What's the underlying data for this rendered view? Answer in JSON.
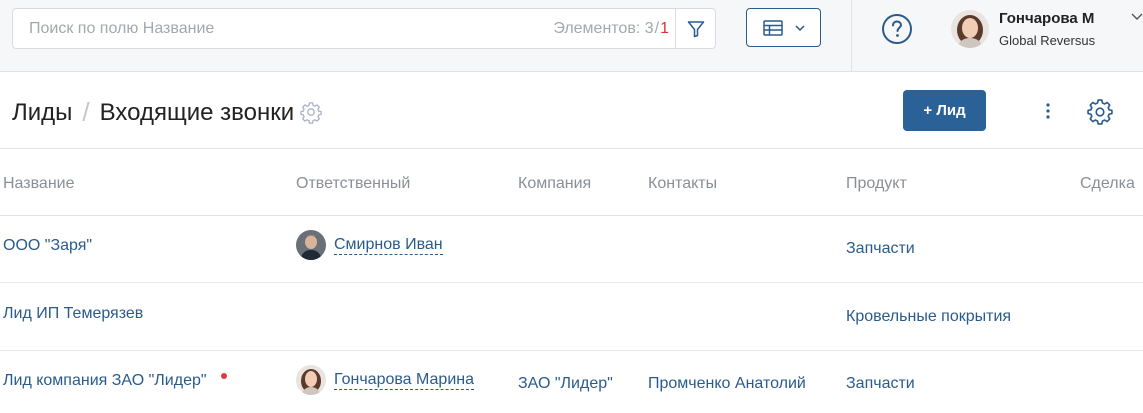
{
  "search": {
    "placeholder": "Поиск по полю Название",
    "count_label": "Элементов:",
    "count_value": "3",
    "count_sep": "/",
    "count_selected": "1"
  },
  "icons": {
    "filter": "filter-icon",
    "view": "table-view-icon",
    "help": "help-icon",
    "gear": "gear-icon",
    "more": "more-vertical-icon"
  },
  "user": {
    "name": "Гончарова М",
    "company": "Global Reversus"
  },
  "header": {
    "crumb_root": "Лиды",
    "crumb_sep": "/",
    "title": "Входящие звонки",
    "add_button": "+ Лид"
  },
  "table": {
    "columns": [
      "Название",
      "Ответственный",
      "Компания",
      "Контакты",
      "Продукт",
      "Сделка"
    ],
    "rows": [
      {
        "name": "ООО \"Заря\"",
        "responsible": "Смирнов Иван",
        "company": "",
        "contacts": "",
        "product": "Запчасти",
        "deal": "",
        "unread": false
      },
      {
        "name": "Лид ИП Темерязев",
        "responsible": "",
        "company": "",
        "contacts": "",
        "product": "Кровельные покрытия",
        "deal": "",
        "unread": false
      },
      {
        "name": "Лид компания ЗАО \"Лидер\"",
        "responsible": "Гончарова Марина",
        "company": "ЗАО \"Лидер\"",
        "contacts": "Промченко Анатолий",
        "product": "Запчасти",
        "deal": "",
        "unread": true
      }
    ]
  },
  "colors": {
    "accent": "#2a6196",
    "link": "#2a5b8c",
    "alert": "#d63333"
  }
}
